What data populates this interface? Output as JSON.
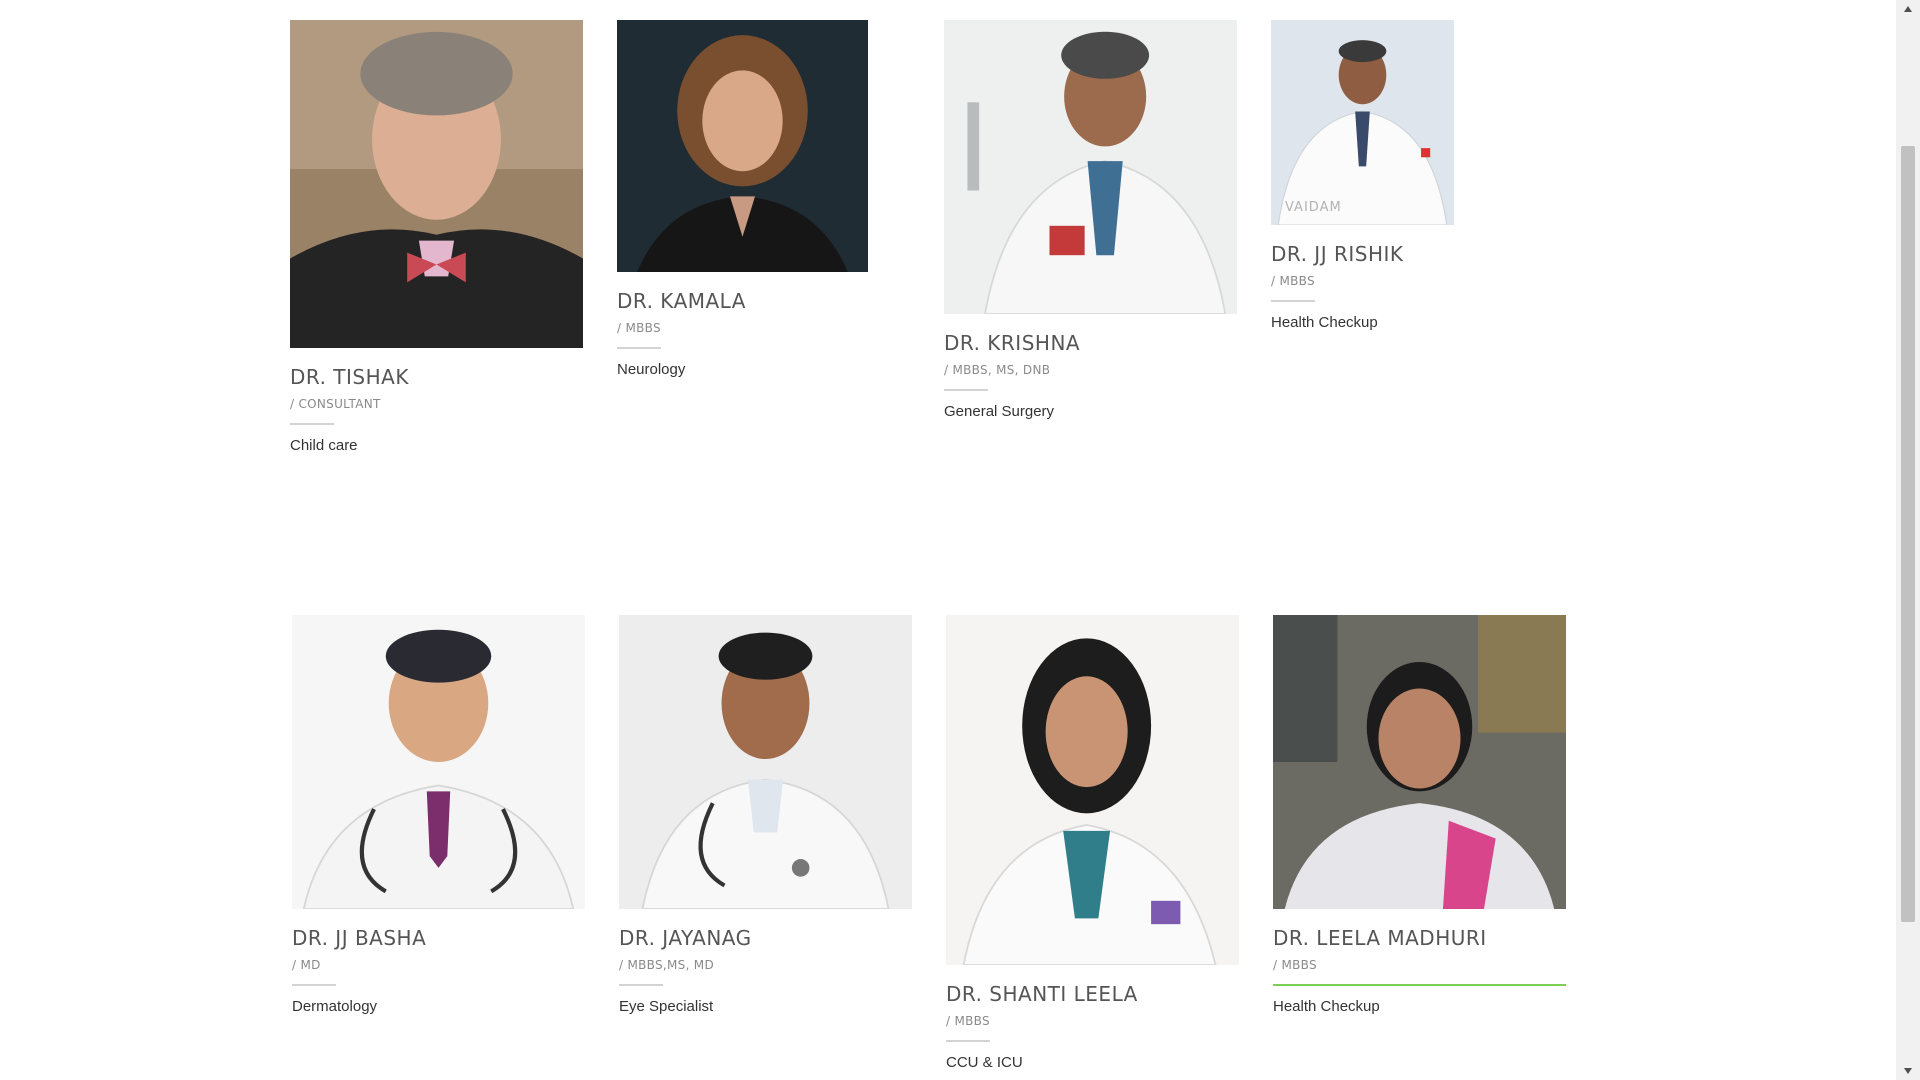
{
  "doctors": [
    {
      "name": "DR. TISHAK",
      "qualification": "/ CONSULTANT",
      "specialty": "Child care",
      "photo_icon": "doctor-portrait"
    },
    {
      "name": "DR. KAMALA",
      "qualification": "/ MBBS",
      "specialty": "Neurology",
      "photo_icon": "doctor-portrait"
    },
    {
      "name": "DR. KRISHNA",
      "qualification": "/ MBBS, MS, DNB",
      "specialty": "General Surgery",
      "photo_icon": "doctor-portrait"
    },
    {
      "name": "DR. JJ RISHIK",
      "qualification": "/ MBBS",
      "specialty": "Health Checkup",
      "photo_icon": "doctor-portrait",
      "photo_watermark": "VAIDAM"
    },
    {
      "name": "DR. JJ BASHA",
      "qualification": "/ MD",
      "specialty": "Dermatology",
      "photo_icon": "doctor-portrait"
    },
    {
      "name": "DR. JAYANAG",
      "qualification": "/ MBBS,MS, MD",
      "specialty": "Eye Specialist",
      "photo_icon": "doctor-portrait"
    },
    {
      "name": "DR. SHANTI LEELA",
      "qualification": "/ MBBS",
      "specialty": "CCU & ICU",
      "photo_icon": "doctor-portrait"
    },
    {
      "name": "DR. LEELA MADHURI",
      "qualification": "/ MBBS",
      "specialty": "Health Checkup",
      "photo_icon": "doctor-portrait",
      "highlighted": true
    }
  ],
  "colors": {
    "name_text": "#555555",
    "qualification_text": "#8a8a8a",
    "divider": "#d3d3d3",
    "active_divider": "#7ccf55",
    "specialty_text": "#333333"
  },
  "scrollbar": {
    "up_icon": "triangle-up-icon",
    "down_icon": "triangle-down-icon"
  }
}
